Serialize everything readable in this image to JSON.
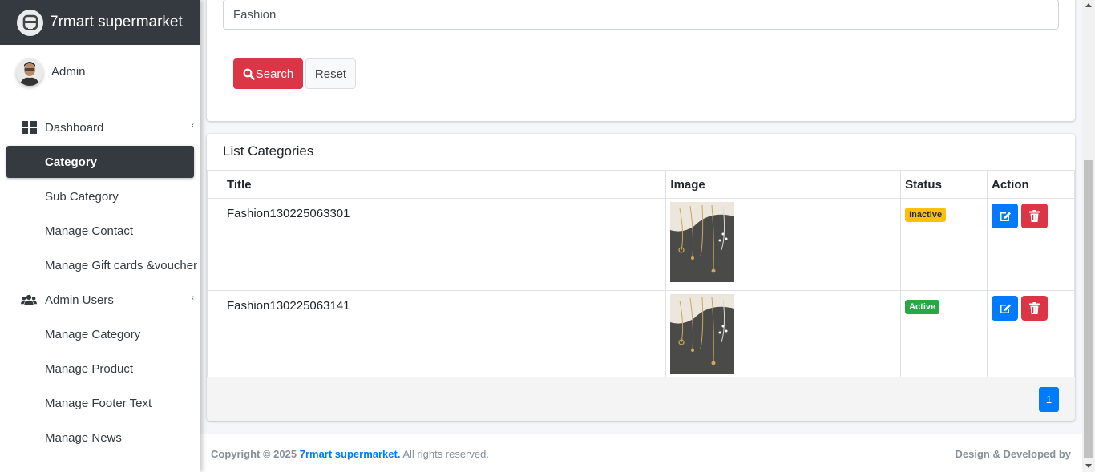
{
  "brand": {
    "title": "7rmart supermarket"
  },
  "user": {
    "name": "Admin"
  },
  "sidebar": {
    "items": [
      {
        "label": "Dashboard",
        "icon": "dashboard-icon",
        "has_caret": true,
        "active": false
      },
      {
        "label": "Category",
        "active": true
      },
      {
        "label": "Sub Category",
        "active": false
      },
      {
        "label": "Manage Contact",
        "active": false
      },
      {
        "label": "Manage Gift cards &voucher",
        "active": false
      },
      {
        "label": "Admin Users",
        "icon": "users-icon",
        "has_caret": true,
        "active": false
      },
      {
        "label": "Manage Category",
        "active": false
      },
      {
        "label": "Manage Product",
        "active": false
      },
      {
        "label": "Manage Footer Text",
        "active": false
      },
      {
        "label": "Manage News",
        "active": false
      }
    ]
  },
  "search": {
    "value": "Fashion",
    "search_label": "Search",
    "reset_label": "Reset"
  },
  "list": {
    "title": "List Categories",
    "columns": [
      "Title",
      "Image",
      "Status",
      "Action"
    ],
    "rows": [
      {
        "title": "Fashion130225063301",
        "status": "Inactive",
        "status_color": "#ffc107"
      },
      {
        "title": "Fashion130225063141",
        "status": "Active",
        "status_color": "#28a745"
      }
    ],
    "pagination": {
      "current_page": "1"
    }
  },
  "footer": {
    "copyright_prefix": "Copyright © 2025 ",
    "site_link": "7rmart supermarket.",
    "rights": " All rights reserved.",
    "credit": "Design & Developed by"
  },
  "colors": {
    "sidebar_dark": "#343a40",
    "primary": "#007bff",
    "danger": "#dc3545",
    "warning": "#ffc107",
    "success": "#28a745"
  }
}
